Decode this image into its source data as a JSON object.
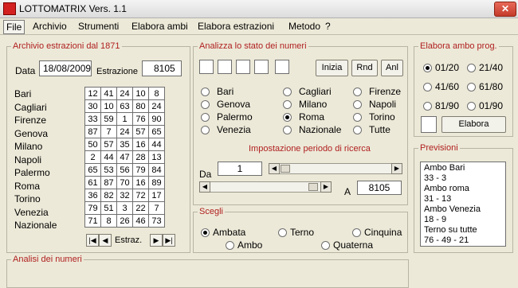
{
  "window": {
    "title": "LOTTOMATRIX  Vers. 1.1",
    "close": "✕"
  },
  "menu": [
    "File",
    "Archivio",
    "Strumenti",
    "Elabora ambi",
    "Elabora estrazioni",
    "Metodo",
    "?"
  ],
  "archivio": {
    "legend": "Archivio estrazioni dal 1871",
    "data_label": "Data",
    "data_value": "18/08/2009",
    "estrazione_label": "Estrazione",
    "estrazione_value": "8105",
    "ruote": [
      {
        "name": "Bari",
        "nums": [
          "12",
          "41",
          "24",
          "10",
          "8"
        ]
      },
      {
        "name": "Cagliari",
        "nums": [
          "30",
          "10",
          "63",
          "80",
          "24"
        ]
      },
      {
        "name": "Firenze",
        "nums": [
          "33",
          "59",
          "1",
          "76",
          "90"
        ]
      },
      {
        "name": "Genova",
        "nums": [
          "87",
          "7",
          "24",
          "57",
          "65"
        ]
      },
      {
        "name": "Milano",
        "nums": [
          "50",
          "57",
          "35",
          "16",
          "44"
        ]
      },
      {
        "name": "Napoli",
        "nums": [
          "2",
          "44",
          "47",
          "28",
          "13"
        ]
      },
      {
        "name": "Palermo",
        "nums": [
          "65",
          "53",
          "56",
          "79",
          "84"
        ]
      },
      {
        "name": "Roma",
        "nums": [
          "61",
          "87",
          "70",
          "16",
          "89"
        ]
      },
      {
        "name": "Torino",
        "nums": [
          "36",
          "82",
          "32",
          "72",
          "17"
        ]
      },
      {
        "name": "Venezia",
        "nums": [
          "79",
          "51",
          "3",
          "22",
          "7"
        ]
      },
      {
        "name": "Nazionale",
        "nums": [
          "71",
          "8",
          "26",
          "46",
          "73"
        ]
      }
    ],
    "nav_label": "Estraz."
  },
  "analizza": {
    "legend": "Analizza lo stato dei numeri",
    "btn_inizia": "Inizia",
    "btn_rnd": "Rnd",
    "btn_anl": "Anl",
    "radios": [
      {
        "label": "Bari",
        "sel": false
      },
      {
        "label": "Cagliari",
        "sel": false
      },
      {
        "label": "Firenze",
        "sel": false
      },
      {
        "label": "Genova",
        "sel": false
      },
      {
        "label": "Milano",
        "sel": false
      },
      {
        "label": "Napoli",
        "sel": false
      },
      {
        "label": "Palermo",
        "sel": false
      },
      {
        "label": "Roma",
        "sel": true
      },
      {
        "label": "Torino",
        "sel": false
      },
      {
        "label": "Venezia",
        "sel": false
      },
      {
        "label": "Nazionale",
        "sel": false
      },
      {
        "label": "Tutte",
        "sel": false
      }
    ],
    "periodo_title": "Impostazione periodo di ricerca",
    "da_label": "Da",
    "da_value": "1",
    "a_label": "A",
    "a_value": "8105"
  },
  "scegli": {
    "legend": "Scegli",
    "options": [
      {
        "label": "Ambata",
        "sel": true
      },
      {
        "label": "Terno",
        "sel": false
      },
      {
        "label": "Cinquina",
        "sel": false
      },
      {
        "label": "Ambo",
        "sel": false
      },
      {
        "label": "Quaterna",
        "sel": false
      }
    ]
  },
  "ambo_prog": {
    "legend": "Elabora ambo prog.",
    "options": [
      {
        "label": "01/20",
        "sel": true
      },
      {
        "label": "21/40",
        "sel": false
      },
      {
        "label": "41/60",
        "sel": false
      },
      {
        "label": "61/80",
        "sel": false
      },
      {
        "label": "81/90",
        "sel": false
      },
      {
        "label": "01/90",
        "sel": false
      }
    ],
    "btn": "Elabora"
  },
  "previsioni": {
    "legend": "Previsioni",
    "lines": [
      "Ambo Bari",
      "33 - 3",
      "Ambo roma",
      "31 - 13",
      "Ambo Venezia",
      "18 - 9",
      "Terno su tutte",
      "76 - 49 - 21"
    ]
  },
  "analisi": {
    "legend": "Analisi dei numeri"
  },
  "colors": {
    "legend": "#b02020",
    "bg": "#ece9d8"
  }
}
